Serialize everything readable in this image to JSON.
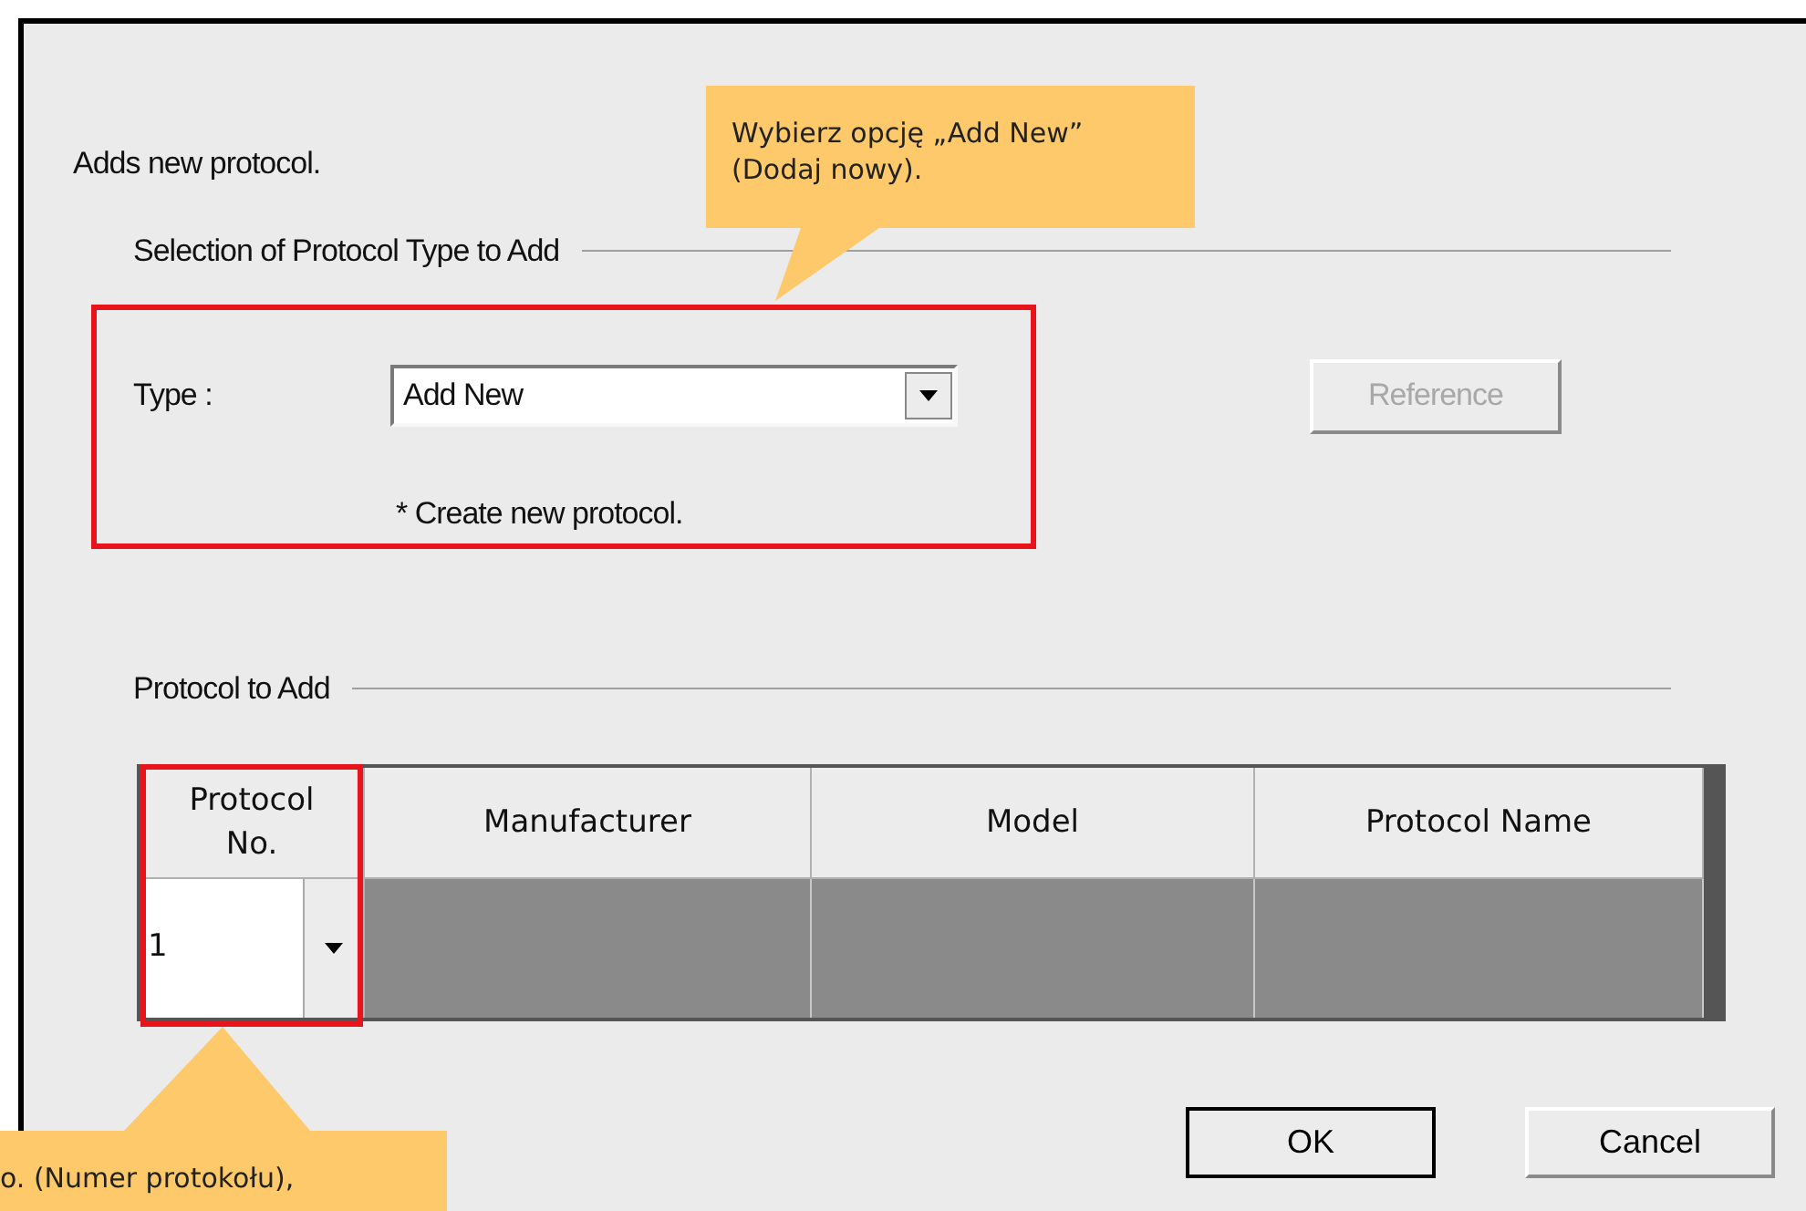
{
  "dialog": {
    "description": "Adds new protocol.",
    "type_section": {
      "title": "Selection of Protocol Type to Add",
      "type_label": "Type :",
      "type_value": "Add New",
      "note": "* Create new protocol.",
      "reference_button": {
        "label": "Reference",
        "disabled": true
      }
    },
    "protocol_section": {
      "title": "Protocol to Add",
      "columns": [
        "Protocol No.",
        "Manufacturer",
        "Model",
        "Protocol Name"
      ],
      "row": {
        "protocol_no": "1"
      }
    },
    "buttons": [
      {
        "label": "OK",
        "default": true
      },
      {
        "label": "Cancel",
        "default": false
      }
    ]
  },
  "callouts": [
    {
      "text": "Wybierz opcję „Add New” (Dodaj nowy)."
    },
    {
      "text": "o. (Numer protokołu),"
    }
  ]
}
